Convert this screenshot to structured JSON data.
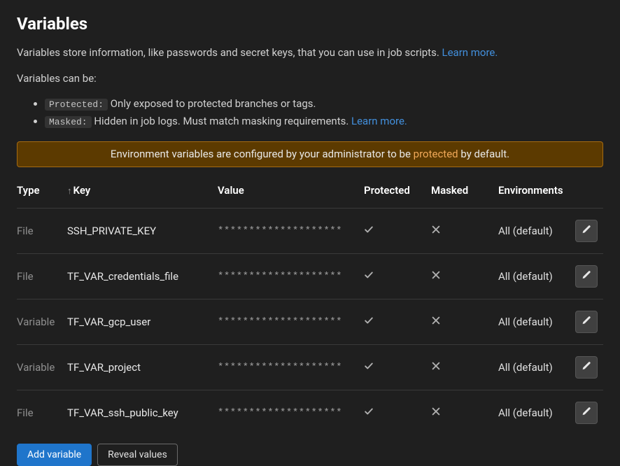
{
  "heading": "Variables",
  "intro_line1": "Variables store information, like passwords and secret keys, that you can use in job scripts. ",
  "learn_more": "Learn more.",
  "intro_line2": "Variables can be:",
  "bullet_protected_tag": "Protected:",
  "bullet_protected_text": " Only exposed to protected branches or tags.",
  "bullet_masked_tag": "Masked:",
  "bullet_masked_text": " Hidden in job logs. Must match masking requirements. ",
  "alert_prefix": "Environment variables are configured by your administrator to be ",
  "alert_link": "protected",
  "alert_suffix": " by default.",
  "columns": {
    "type": "Type",
    "key": "Key",
    "value": "Value",
    "protected": "Protected",
    "masked": "Masked",
    "environments": "Environments"
  },
  "rows": [
    {
      "type": "File",
      "key": "SSH_PRIVATE_KEY",
      "value": "********************",
      "protected": true,
      "masked": false,
      "env": "All (default)"
    },
    {
      "type": "File",
      "key": "TF_VAR_credentials_file",
      "value": "********************",
      "protected": true,
      "masked": false,
      "env": "All (default)"
    },
    {
      "type": "Variable",
      "key": "TF_VAR_gcp_user",
      "value": "********************",
      "protected": true,
      "masked": false,
      "env": "All (default)"
    },
    {
      "type": "Variable",
      "key": "TF_VAR_project",
      "value": "********************",
      "protected": true,
      "masked": false,
      "env": "All (default)"
    },
    {
      "type": "File",
      "key": "TF_VAR_ssh_public_key",
      "value": "********************",
      "protected": true,
      "masked": false,
      "env": "All (default)"
    }
  ],
  "buttons": {
    "add": "Add variable",
    "reveal": "Reveal values"
  }
}
